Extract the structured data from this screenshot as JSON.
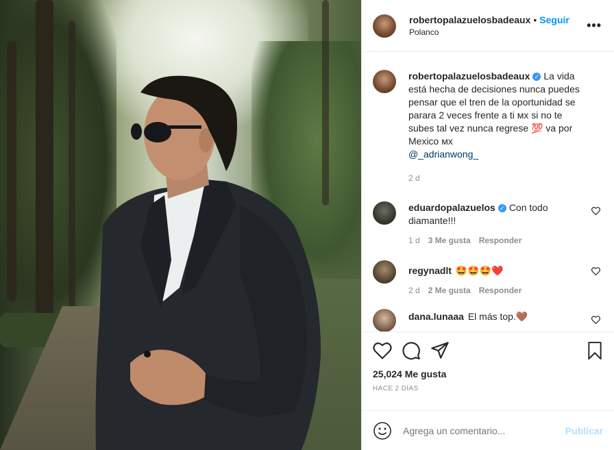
{
  "post": {
    "username": "robertopalazuelosbadeaux",
    "header_username": "robertopalazuelosbadeaux",
    "follow_label": "Seguir",
    "dot": "•",
    "location": "Polanco",
    "more_label": "•••",
    "verified_glyph": "✓"
  },
  "caption": {
    "username": "robertopalazuelosbadeaux",
    "text_1": "La vida está hecha de decisiones nunca puedes pensar que el tren de la oportunidad se parara 2 veces frente a ti",
    "flag_1": "ᴍx",
    "text_2": "si no te subes tal vez nunca regrese",
    "emoji_100": "💯",
    "text_3": "va por Mexico",
    "flag_2": "ᴍx",
    "mention": "@_adrianwong_",
    "time": "2 d"
  },
  "comments": [
    {
      "username": "eduardopalazuelos",
      "verified": true,
      "text": "Con todo diamante!!!",
      "time": "1 d",
      "likes": "3 Me gusta",
      "reply": "Responder"
    },
    {
      "username": "regynadlt",
      "verified": false,
      "text": "🤩🤩🤩❤️",
      "time": "2 d",
      "likes": "2 Me gusta",
      "reply": "Responder"
    },
    {
      "username": "dana.lunaaa",
      "verified": false,
      "text": "El más top.🤎"
    }
  ],
  "actions": {
    "like_icon": "heart-icon",
    "comment_icon": "comment-bubble-icon",
    "share_icon": "send-icon",
    "save_icon": "bookmark-icon",
    "likes_count": "25,024 Me gusta",
    "posted": "HACE 2 DÍAS"
  },
  "add_comment": {
    "placeholder": "Agrega un comentario...",
    "post_label": "Publicar",
    "emoji_icon": "smiley-icon"
  },
  "colors": {
    "link_blue": "#0095f6",
    "verified_blue": "#3897f0",
    "muted": "#8e8e8e",
    "post_disabled": "#b2dffc"
  }
}
